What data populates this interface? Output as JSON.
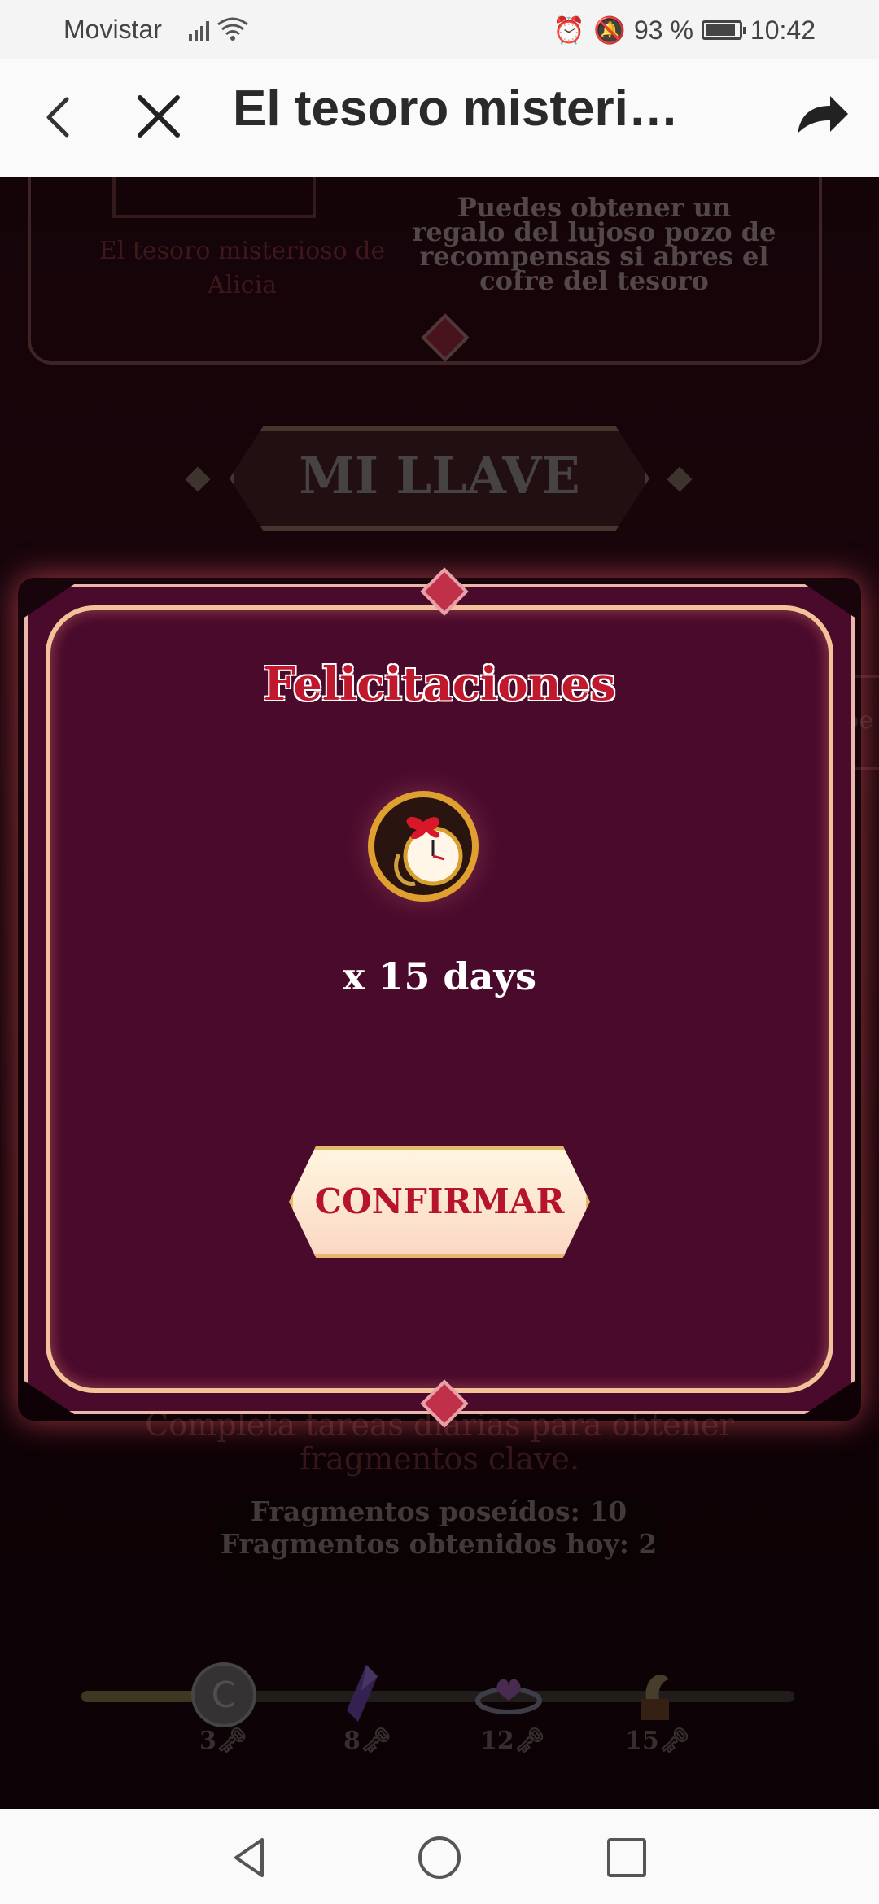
{
  "status_bar": {
    "carrier": "Movistar",
    "battery": "93 %",
    "time": "10:42"
  },
  "app_bar": {
    "title": "El tesoro misteri…"
  },
  "game": {
    "alicia_text": "El tesoro misterioso de Alicia",
    "description": "Puedes obtener un regalo del lujoso pozo de recompensas si abres el cofre del tesoro",
    "key_heading": "MI LLAVE",
    "daily_tasks": "Completa tareas diarias para obtener fragmentos clave.",
    "fragments_owned": "Fragmentos poseídos: 10",
    "fragments_today": "Fragmentos obtenidos hoy: 2",
    "progress_fraction": 0.19,
    "milestones": [
      {
        "count": "3",
        "item": "coin-icon"
      },
      {
        "count": "8",
        "item": "crystal-icon"
      },
      {
        "count": "12",
        "item": "tiara-icon"
      },
      {
        "count": "15",
        "item": "music-box-icon"
      }
    ]
  },
  "modal": {
    "title": "Felicitaciones",
    "reward_item": "pocket-watch-icon",
    "quantity": "x 15 days",
    "confirm_label": "CONFIRMAR"
  },
  "colors": {
    "modal_bg": "#4a0a2c",
    "title_red": "#c0182c",
    "frame_gold": "#f2c39a"
  }
}
